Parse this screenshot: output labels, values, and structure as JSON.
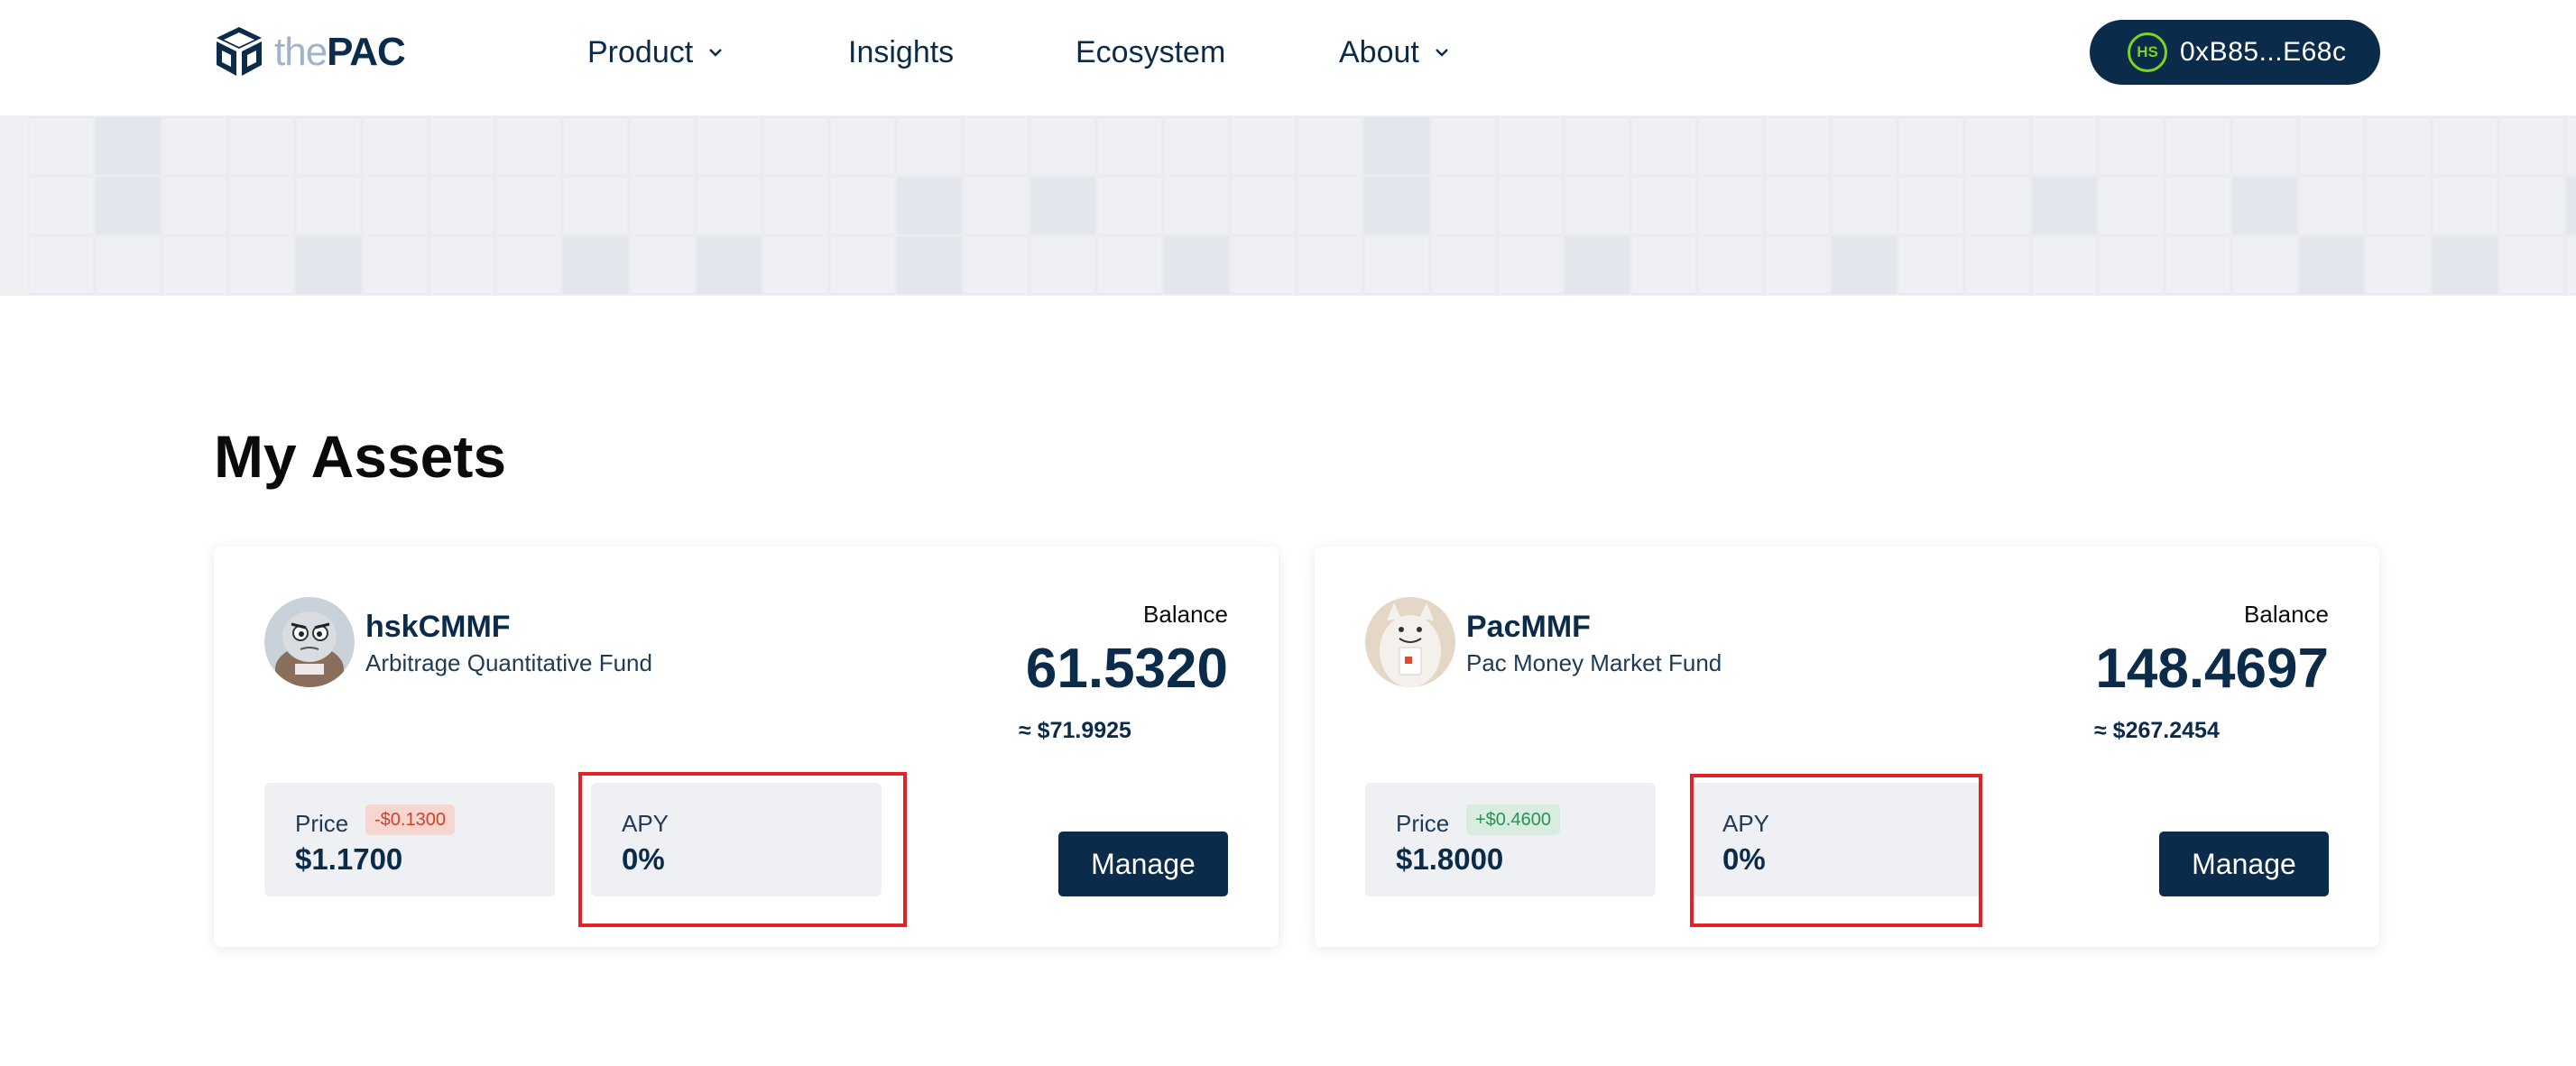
{
  "brand": {
    "logo_prefix": "the",
    "logo_main": "PAC"
  },
  "nav": {
    "items": [
      {
        "label": "Product",
        "has_dropdown": true
      },
      {
        "label": "Insights",
        "has_dropdown": false
      },
      {
        "label": "Ecosystem",
        "has_dropdown": false
      },
      {
        "label": "About",
        "has_dropdown": true
      }
    ]
  },
  "wallet": {
    "badge": "HS",
    "address": "0xB85...E68c"
  },
  "section": {
    "title": "My Assets"
  },
  "assets": [
    {
      "name": "hskCMMF",
      "description": "Arbitrage Quantitative Fund",
      "avatar_icon": "cartoon-face-avatar",
      "balance_label": "Balance",
      "balance": "61.5320",
      "balance_usd": "≈ $71.9925",
      "price_label": "Price",
      "price": "$1.1700",
      "price_change": "-$0.1300",
      "price_change_direction": "negative",
      "apy_label": "APY",
      "apy": "0%",
      "manage_label": "Manage"
    },
    {
      "name": "PacMMF",
      "description": "Pac Money Market Fund",
      "avatar_icon": "cat-with-card-avatar",
      "balance_label": "Balance",
      "balance": "148.4697",
      "balance_usd": "≈ $267.2454",
      "price_label": "Price",
      "price": "$1.8000",
      "price_change": "+$0.4600",
      "price_change_direction": "positive",
      "apy_label": "APY",
      "apy": "0%",
      "manage_label": "Manage"
    }
  ],
  "colors": {
    "primary": "#0b2b4a",
    "negative": "#d0402b",
    "positive": "#2e8f57",
    "highlight": "#e32228",
    "wallet_badge": "#7ed321"
  }
}
